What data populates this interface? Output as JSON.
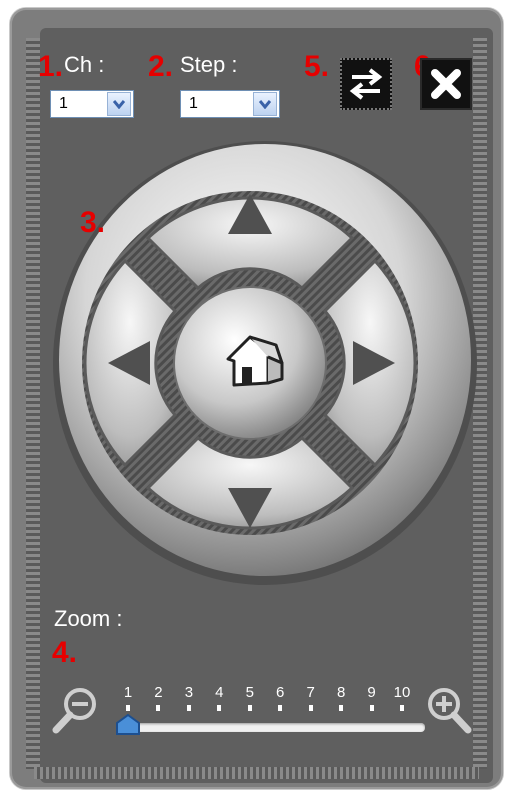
{
  "annotations": {
    "n1": "1.",
    "n2": "2.",
    "n3": "3.",
    "n4": "4.",
    "n5": "5.",
    "n6": "6."
  },
  "channel": {
    "label": "Ch :",
    "value": "1"
  },
  "step": {
    "label": "Step :",
    "value": "1"
  },
  "buttons": {
    "swap_icon": "swap-arrows-icon",
    "close_icon": "close-x-icon"
  },
  "pad": {
    "icons": [
      "up-arrow-icon",
      "down-arrow-icon",
      "left-arrow-icon",
      "right-arrow-icon",
      "home-icon"
    ]
  },
  "zoom": {
    "label": "Zoom :",
    "ticks": [
      "1",
      "2",
      "3",
      "4",
      "5",
      "6",
      "7",
      "8",
      "9",
      "10"
    ],
    "level": 1,
    "min": 1,
    "max": 10,
    "zoom_out_icon": "zoom-out-icon",
    "zoom_in_icon": "zoom-in-icon"
  },
  "colors": {
    "annotation": "#e60000",
    "panel": "#5f5f5f",
    "select_arrow": "#3a62a8"
  }
}
